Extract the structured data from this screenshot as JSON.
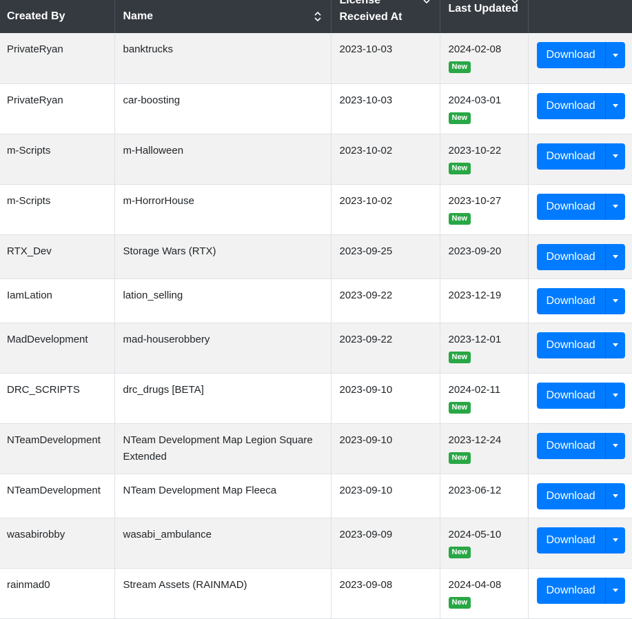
{
  "table": {
    "headers": [
      "Created By",
      "Name",
      "License Received At",
      "Last Updated",
      ""
    ],
    "download_label": "Download",
    "new_label": "New",
    "rows": [
      {
        "created_by": "PrivateRyan",
        "name": "banktrucks",
        "received": "2023-10-03",
        "updated": "2024-02-08",
        "is_new": true
      },
      {
        "created_by": "PrivateRyan",
        "name": "car-boosting",
        "received": "2023-10-03",
        "updated": "2024-03-01",
        "is_new": true
      },
      {
        "created_by": "m-Scripts",
        "name": "m-Halloween",
        "received": "2023-10-02",
        "updated": "2023-10-22",
        "is_new": true
      },
      {
        "created_by": "m-Scripts",
        "name": "m-HorrorHouse",
        "received": "2023-10-02",
        "updated": "2023-10-27",
        "is_new": true
      },
      {
        "created_by": "RTX_Dev",
        "name": "Storage Wars (RTX)",
        "received": "2023-09-25",
        "updated": "2023-09-20",
        "is_new": false
      },
      {
        "created_by": "IamLation",
        "name": "lation_selling",
        "received": "2023-09-22",
        "updated": "2023-12-19",
        "is_new": false
      },
      {
        "created_by": "MadDevelopment",
        "name": "mad-houserobbery",
        "received": "2023-09-22",
        "updated": "2023-12-01",
        "is_new": true
      },
      {
        "created_by": "DRC_SCRIPTS",
        "name": "drc_drugs [BETA]",
        "received": "2023-09-10",
        "updated": "2024-02-11",
        "is_new": true
      },
      {
        "created_by": "NTeamDevelopment",
        "name": "NTeam Development Map Legion Square Extended",
        "received": "2023-09-10",
        "updated": "2023-12-24",
        "is_new": true
      },
      {
        "created_by": "NTeamDevelopment",
        "name": "NTeam Development Map Fleeca",
        "received": "2023-09-10",
        "updated": "2023-06-12",
        "is_new": false
      },
      {
        "created_by": "wasabirobby",
        "name": "wasabi_ambulance",
        "received": "2023-09-09",
        "updated": "2024-05-10",
        "is_new": true
      },
      {
        "created_by": "rainmad0",
        "name": "Stream Assets (RAINMAD)",
        "received": "2023-09-08",
        "updated": "2024-04-08",
        "is_new": true
      }
    ]
  }
}
